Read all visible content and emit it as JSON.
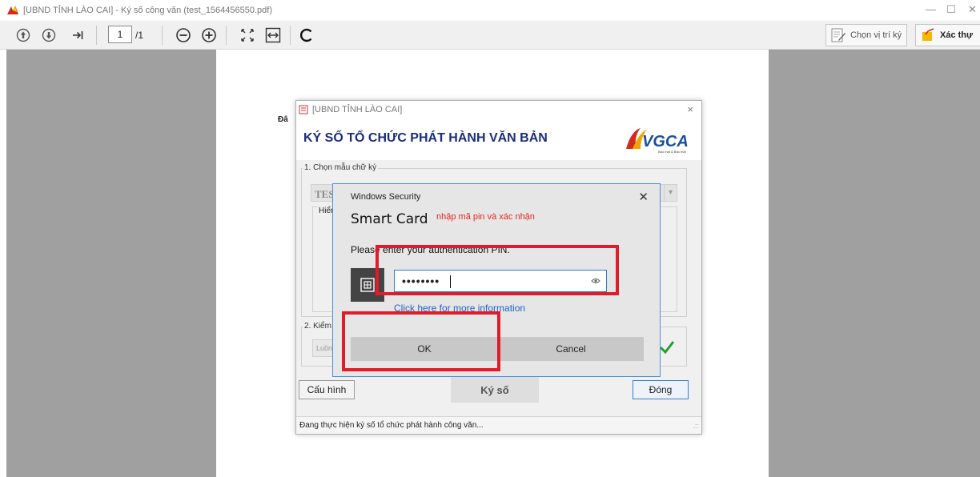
{
  "window": {
    "title": "[UBND TỈNH LÀO CAI] - Ký số công văn (test_1564456550.pdf)",
    "minimize": "—",
    "maximize": "☐",
    "close": "✕"
  },
  "toolbar": {
    "page_current": "1",
    "page_total": "/1",
    "choose_position_label": "Chọn vị trí ký",
    "verify_label": "Xác thự"
  },
  "document": {
    "snippet": "Đâ"
  },
  "sign_dialog": {
    "title": "[UBND TỈNH LÀO CAI]",
    "close": "×",
    "heading": "KÝ SỐ TỔ CHỨC PHÁT HÀNH VĂN BẢN",
    "logo_text": "VGCA",
    "logo_tagline": "Bảo mật & Bảo mật",
    "group1_label": "1. Chọn mẫu chữ ký",
    "template_value": "TES",
    "preview_label": "Hiển",
    "group2_label": "2. Kiểm",
    "verify_value": "Luồn",
    "config_button": "Cấu hình",
    "sign_button": "Ký số",
    "close_button": "Đóng",
    "status_text": "Đang thực hiện ký số tổ chức phát hành công văn...",
    "grip": ".::"
  },
  "security_dialog": {
    "title": "Windows Security",
    "close": "✕",
    "heading": "Smart Card",
    "annotation": "nhập mã pin và xác nhận",
    "prompt": "Please enter your authentication PIN.",
    "pin_masked": "••••••••",
    "link_text": "Click here for more information",
    "ok_button": "OK",
    "cancel_button": "Cancel"
  },
  "colors": {
    "highlight": "#e01b2b",
    "heading_blue": "#1b2d7a",
    "link_blue": "#1e63c8",
    "check_green": "#22a32d"
  }
}
